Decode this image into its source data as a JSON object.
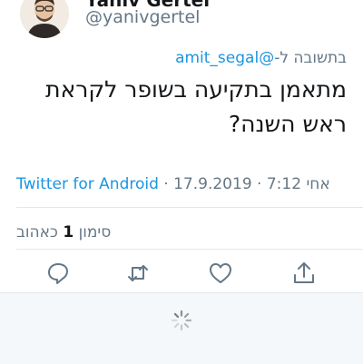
{
  "tweet": {
    "display_name": "Yaniv Gertel",
    "handle": "@yanivgertel",
    "reply_prefix": "בתשובה ל-",
    "reply_mention": "@amit_segal",
    "text": "מתאמן בתקיעה בשופר לקראת ראש השנה?",
    "time": "7:12 אחי",
    "date": "17.9.2019",
    "separator": " · ",
    "source": "Twitter for Android",
    "likes_label_before": "סימון",
    "likes_count": "1",
    "likes_label_after": "כאהוב"
  },
  "actions": [
    {
      "name": "reply-icon"
    },
    {
      "name": "retweet-icon"
    },
    {
      "name": "like-icon"
    },
    {
      "name": "share-icon"
    }
  ],
  "colors": {
    "link": "#1b95e0",
    "secondary": "#657786",
    "primary": "#14171a",
    "divider": "#e1e8ed"
  }
}
